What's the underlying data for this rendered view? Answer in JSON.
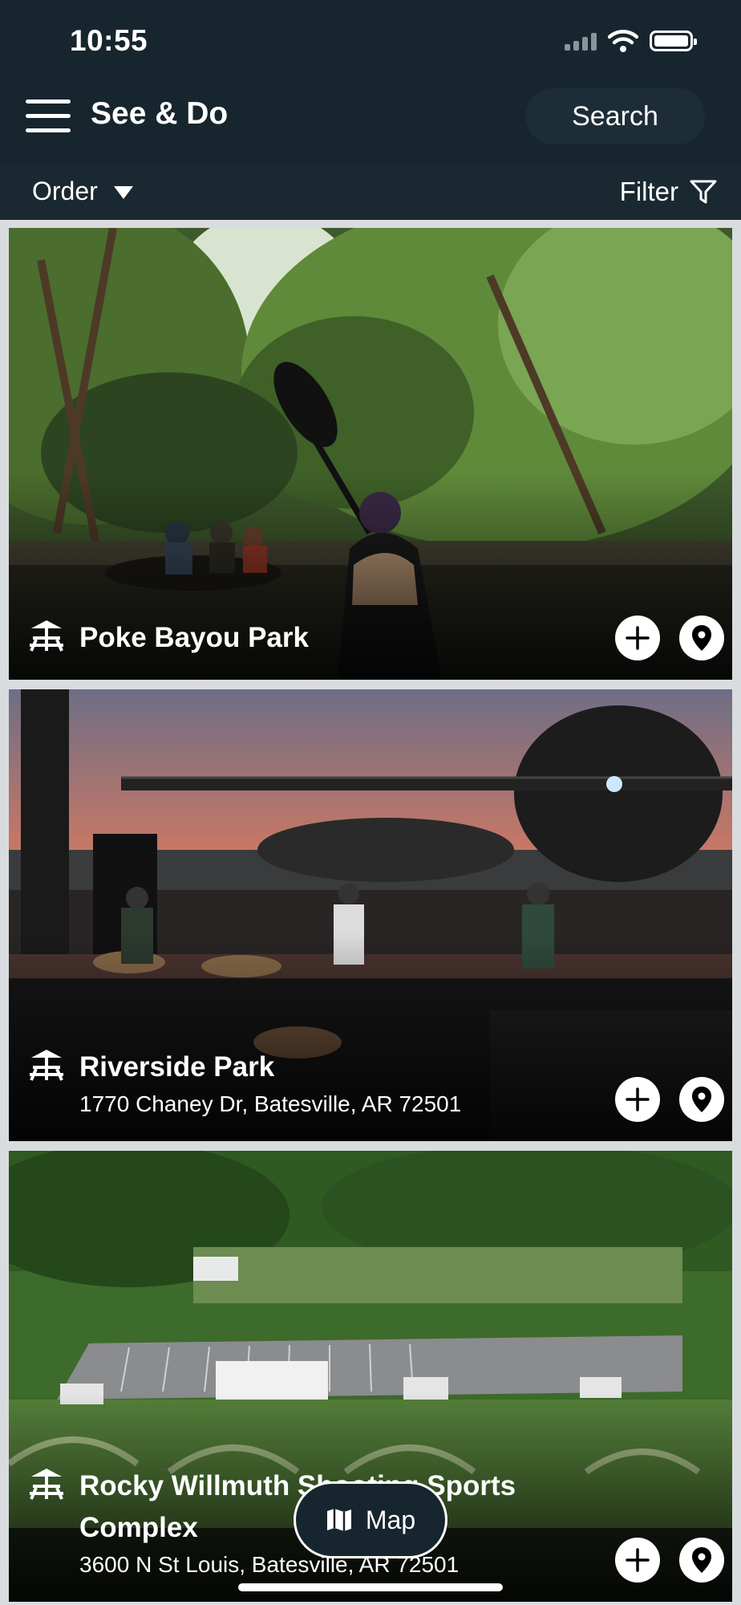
{
  "status_bar": {
    "time": "10:55"
  },
  "nav": {
    "title": "See & Do",
    "search_label": "Search"
  },
  "subbar": {
    "order_label": "Order",
    "filter_label": "Filter"
  },
  "cards": [
    {
      "title": "Poke Bayou Park",
      "address": ""
    },
    {
      "title": "Riverside Park",
      "address": "1770 Chaney Dr, Batesville, AR 72501"
    },
    {
      "title": "Rocky Willmuth Shooting Sports Complex",
      "address": "3600 N St Louis, Batesville, AR 72501"
    }
  ],
  "map_button": {
    "label": "Map"
  },
  "icons": {
    "menu": "hamburger-icon",
    "order": "triangle-down-icon",
    "filter": "funnel-icon",
    "category": "park-picnic-icon",
    "add": "plus-icon",
    "location": "map-pin-icon",
    "map": "folded-map-icon"
  },
  "colors": {
    "header_bg": "#17252e",
    "subbar_bg": "#1a2831",
    "page_bg": "#d9dcde"
  }
}
